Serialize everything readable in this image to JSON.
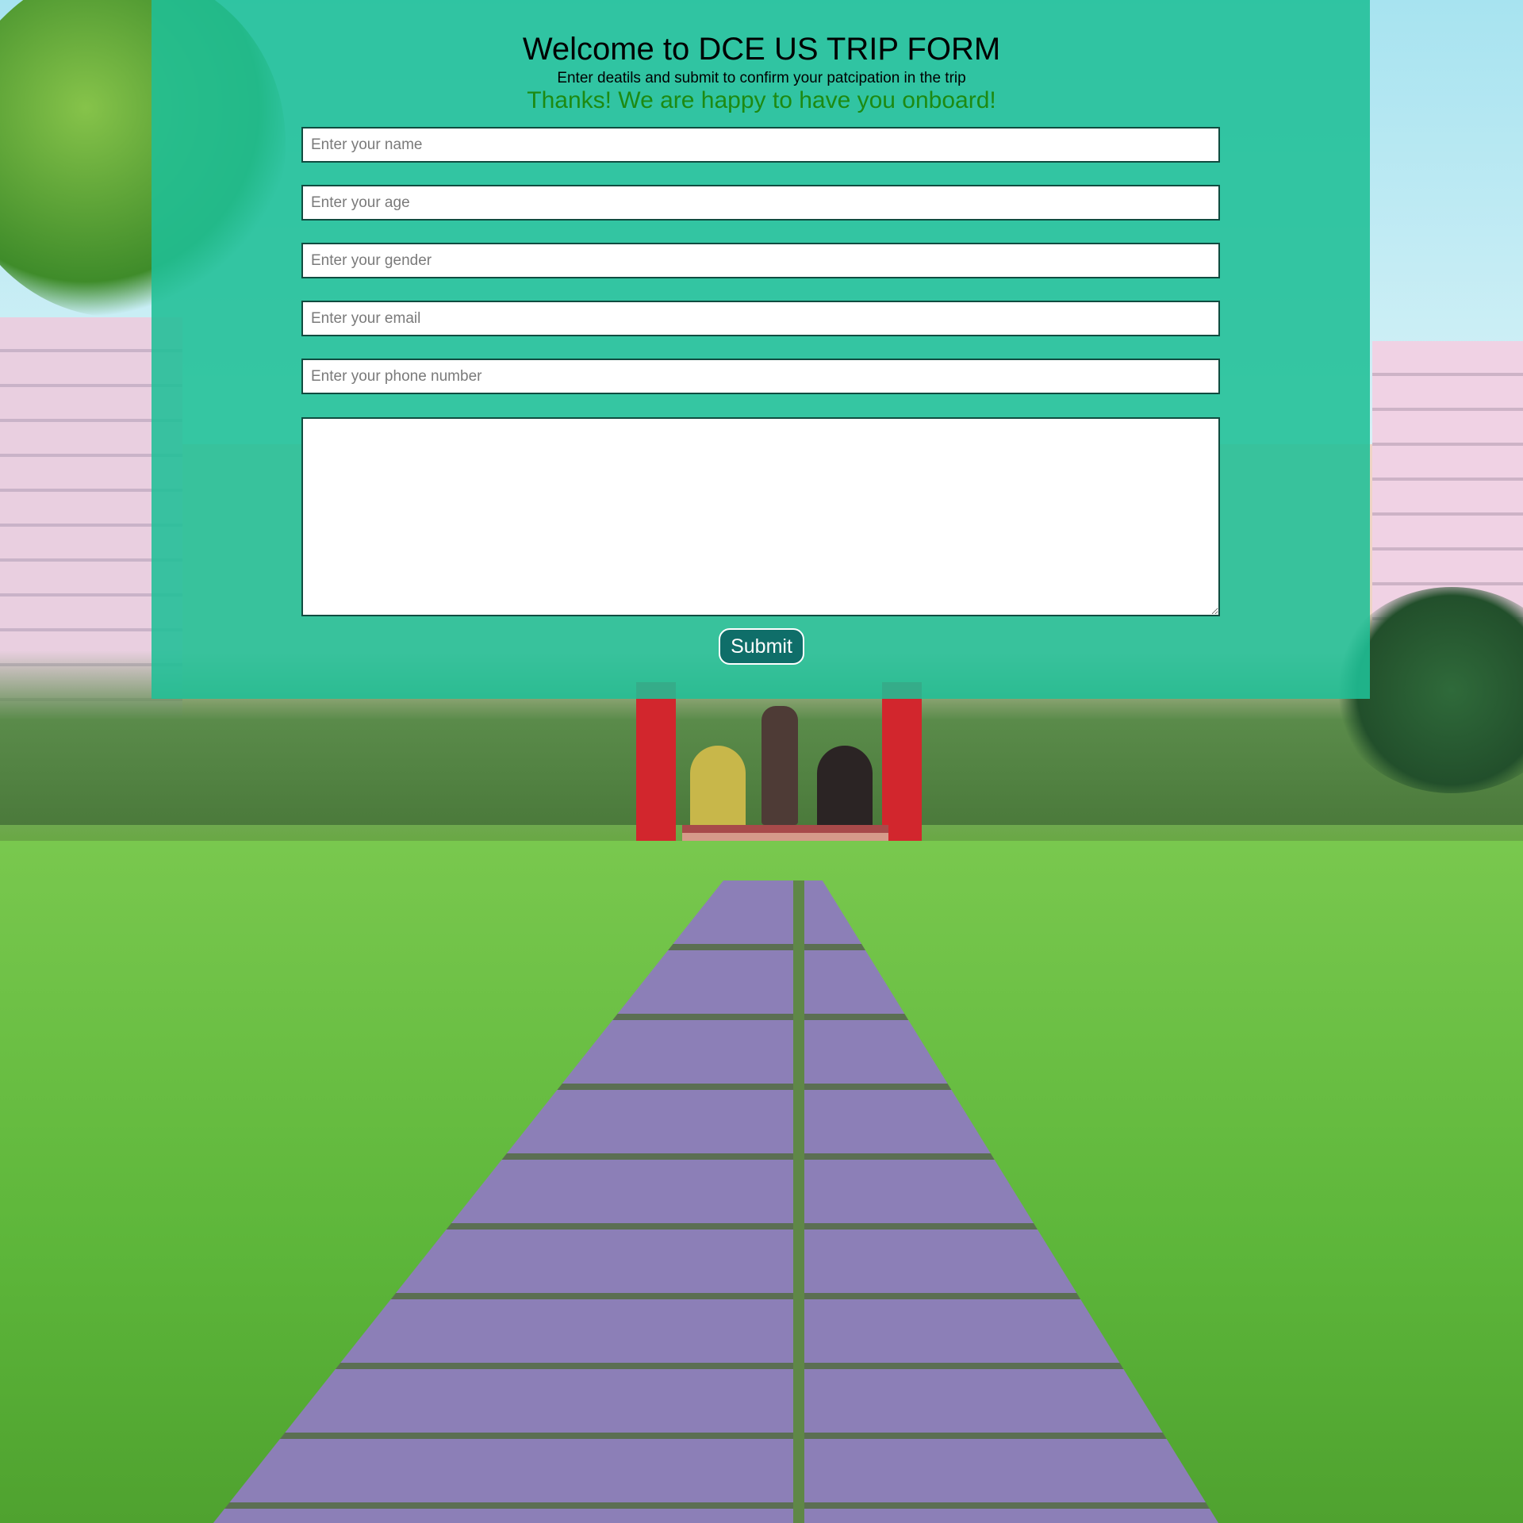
{
  "header": {
    "title": "Welcome to DCE US TRIP FORM",
    "subtitle": "Enter deatils and submit to confirm your patcipation in the trip",
    "success_message": "Thanks! We are happy to have you onboard!"
  },
  "form": {
    "name_placeholder": "Enter your name",
    "age_placeholder": "Enter your age",
    "gender_placeholder": "Enter your gender",
    "email_placeholder": "Enter your email",
    "phone_placeholder": "Enter your phone number",
    "comments_value": "",
    "submit_label": "Submit"
  },
  "colors": {
    "overlay": "#1fbf96",
    "success_text": "#1d8a12",
    "button_bg": "#0f6e69",
    "field_border": "#104c40"
  }
}
